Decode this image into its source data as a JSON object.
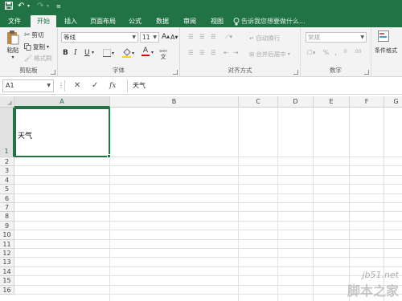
{
  "tabs": [
    "文件",
    "开始",
    "插入",
    "页面布局",
    "公式",
    "数据",
    "审阅",
    "视图"
  ],
  "active_tab": "开始",
  "tell_me": "告诉我您想要做什么...",
  "clipboard": {
    "paste": "粘贴",
    "cut": "剪切",
    "copy": "复制",
    "format_painter": "格式刷",
    "label": "剪贴板"
  },
  "font": {
    "name": "等线",
    "size": "11",
    "grow": "A",
    "shrink": "A",
    "bold": "B",
    "italic": "I",
    "underline": "U",
    "wen": "wén",
    "label": "字体",
    "font_color": "A"
  },
  "alignment": {
    "wrap": "自动换行",
    "merge": "合并后居中",
    "label": "对齐方式"
  },
  "number": {
    "format": "常规",
    "label": "数字"
  },
  "styles": {
    "conditional": "条件格式"
  },
  "formula_bar": {
    "name_box": "A1",
    "fx": "fx",
    "value": "天气"
  },
  "columns": [
    "A",
    "B",
    "C",
    "D",
    "E",
    "F",
    "G"
  ],
  "rows": [
    "1",
    "2",
    "3",
    "4",
    "5",
    "6",
    "7",
    "8",
    "9",
    "10",
    "11",
    "12",
    "13",
    "14",
    "15",
    "16"
  ],
  "selected_cell": "A1",
  "cell_a1": "天气",
  "watermark": {
    "line1": "jb51.net",
    "line2": "脚本之家"
  },
  "colors": {
    "accent": "#217346",
    "font_color_bar": "#e00000"
  }
}
